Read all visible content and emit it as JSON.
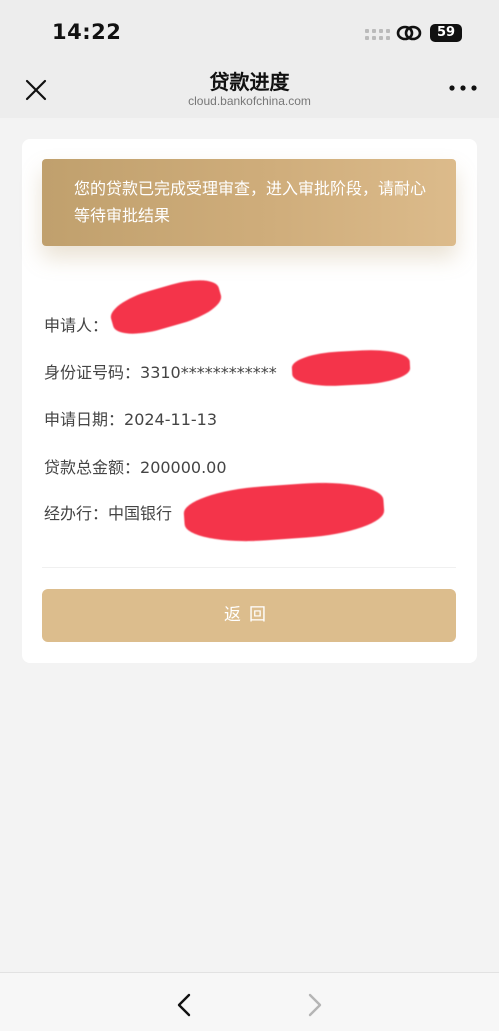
{
  "status_bar": {
    "time": "14:22",
    "battery": "59"
  },
  "header": {
    "title": "贷款进度",
    "url": "cloud.bankofchina.com"
  },
  "notice": {
    "text": "您的贷款已完成受理审查，进入审批阶段，请耐心等待审批结果"
  },
  "applicant": {
    "label": "申请人："
  },
  "id_number": {
    "label": "身份证号码：",
    "value": "3310************"
  },
  "apply_date": {
    "label": "申请日期：",
    "value": "2024-11-13"
  },
  "loan_amount": {
    "label": "贷款总金额：",
    "value": "200000.00"
  },
  "branch": {
    "label": "经办行：",
    "value": "中国银行"
  },
  "actions": {
    "return_label": "返回"
  },
  "colors": {
    "accent": "#dcbd8d",
    "banner": "#c9a773",
    "redaction": "#f4344a"
  }
}
